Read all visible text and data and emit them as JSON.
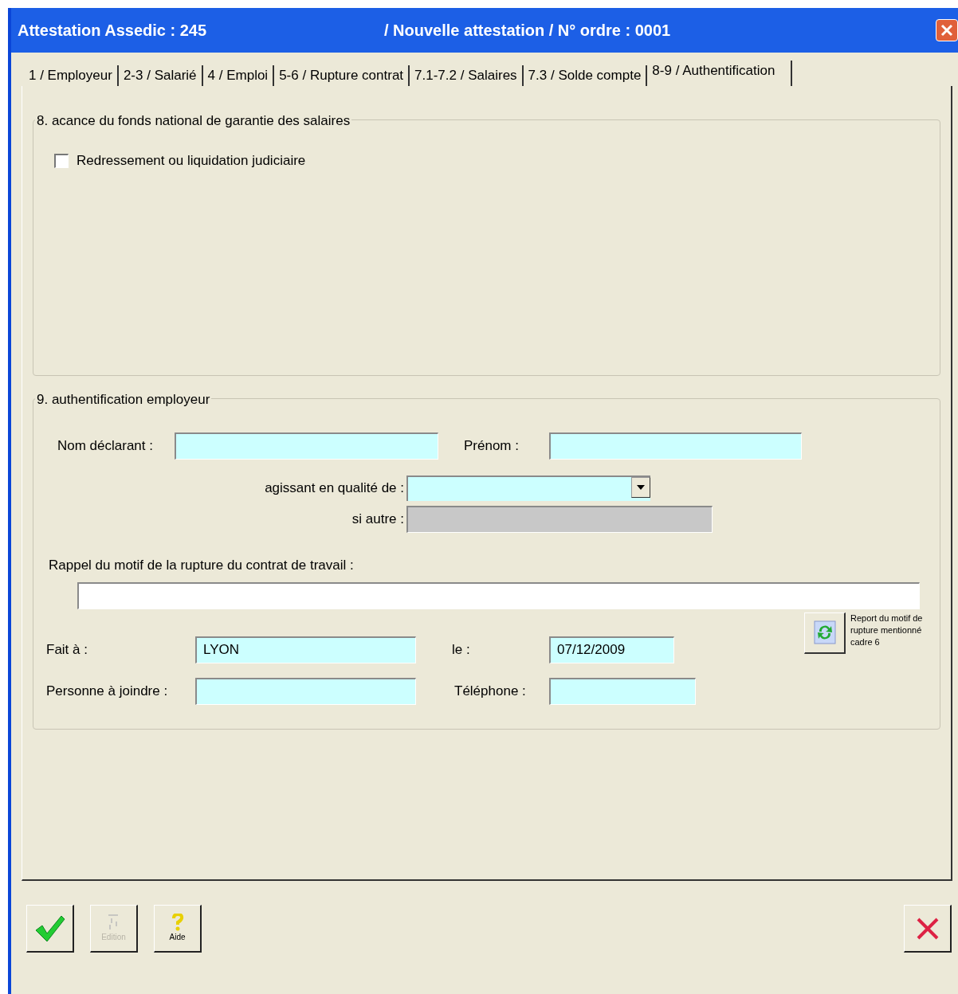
{
  "window": {
    "title": "Attestation Assedic : 245",
    "subtitle": "/ Nouvelle attestation / N° ordre : 0001"
  },
  "tabs": [
    {
      "label": "1 / Employeur",
      "selected": false
    },
    {
      "label": "2-3 / Salarié",
      "selected": false
    },
    {
      "label": "4 / Emploi",
      "selected": false
    },
    {
      "label": "5-6 / Rupture contrat",
      "selected": false
    },
    {
      "label": "7.1-7.2 / Salaires",
      "selected": false
    },
    {
      "label": "7.3 / Solde compte",
      "selected": false
    },
    {
      "label": "8-9 / Authentification",
      "selected": true
    }
  ],
  "section8": {
    "title": "8. acance du fonds national de garantie des salaires",
    "checkbox": {
      "label": "Redressement ou liquidation judiciaire",
      "checked": false
    }
  },
  "section9": {
    "title": "9. authentification employeur",
    "nom_declarant": {
      "label": "Nom déclarant :"
    },
    "prenom": {
      "label": "Prénom :"
    },
    "qualite": {
      "label": "agissant en qualité de :"
    },
    "si_autre": {
      "label": "si autre :",
      "disabled": true
    },
    "rappel": {
      "label": "Rappel du motif de la rupture du contrat de travail :"
    },
    "report_button": {
      "caption": "Report du motif de rupture mentionné cadre 6"
    },
    "fait_a": {
      "label": "Fait à :",
      "value": "LYON"
    },
    "le": {
      "label": "le :",
      "value": "07/12/2009"
    },
    "personne": {
      "label": "Personne à joindre :"
    },
    "telephone": {
      "label": "Téléphone :"
    }
  },
  "buttons": [
    {
      "kind": "ok",
      "disabled": false
    },
    {
      "kind": "edition",
      "label": "Edition",
      "disabled": true
    },
    {
      "kind": "aide",
      "label": "Aide",
      "disabled": false
    },
    {
      "kind": "cancel",
      "disabled": false
    }
  ]
}
